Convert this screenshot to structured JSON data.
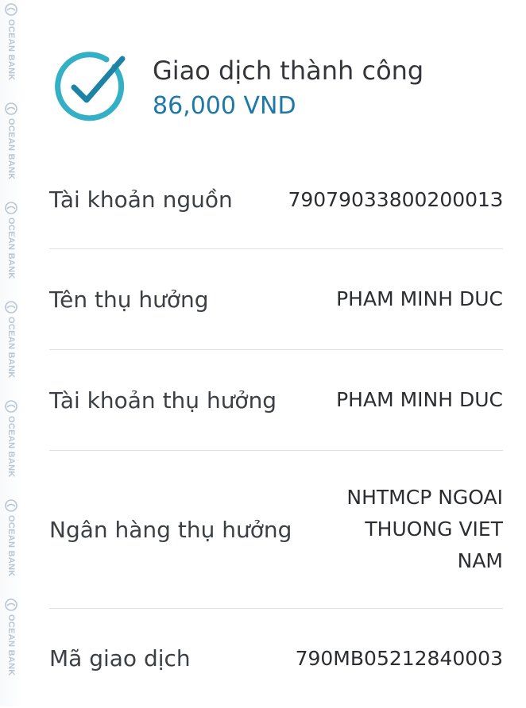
{
  "watermark": {
    "text": "OCEAN BANK",
    "repeat": 7,
    "color": "#b9c6d2"
  },
  "header": {
    "status_title": "Giao dịch thành công",
    "amount": "86,000 VND",
    "icon": "check-circle-icon",
    "accent_color": "#1e78a8"
  },
  "details": [
    {
      "label": "Tài khoản nguồn",
      "value": "7907903380020001З"
    },
    {
      "label": "Tên thụ hưởng",
      "value": "PHAM MINH DUC"
    },
    {
      "label": "Tài khoản thụ hưởng",
      "value": "PHAM MINH DUC"
    },
    {
      "label": "Ngân hàng thụ hưởng",
      "value": "NHTMCP NGOAI THUONG VIET NAM"
    },
    {
      "label": "Mã giao dịch",
      "value": "790MB05212840003"
    }
  ]
}
